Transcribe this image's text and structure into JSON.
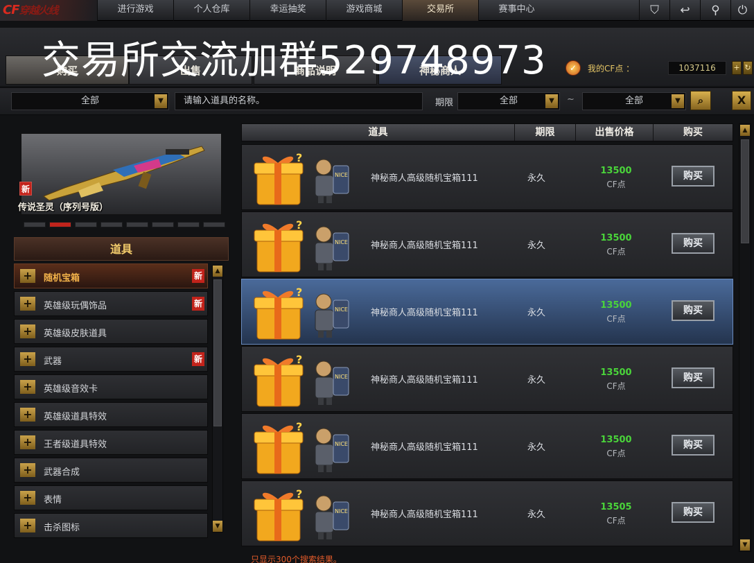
{
  "logo": {
    "text": "CF",
    "rest": "穿越火线"
  },
  "nav": {
    "items": [
      "进行游戏",
      "个人仓库",
      "幸运抽奖",
      "游戏商城",
      "交易所",
      "赛事中心"
    ],
    "active_index": 4,
    "icons": [
      "shield-icon",
      "back-icon",
      "wrench-icon",
      "power-icon"
    ]
  },
  "overlay_text": "交易所交流加群529748973",
  "tabs": [
    {
      "label": "购买"
    },
    {
      "label": "出售"
    },
    {
      "label": "商品说明"
    },
    {
      "label": "神秘商人"
    }
  ],
  "cf_points": {
    "label": "我的CF点 ：",
    "value": "1037116",
    "add_button": "+",
    "refresh_button": "↻"
  },
  "search": {
    "category_select": "全部",
    "placeholder": "请输入道具的名称。",
    "period_label": "期限",
    "period_from": "全部",
    "tilde": "~",
    "period_to": "全部",
    "search_icon": "search-icon",
    "close_label": "X"
  },
  "featured": {
    "new_badge": "新",
    "name": "传说圣灵（序列号版）"
  },
  "categories": {
    "header": "道具",
    "items": [
      {
        "label": "随机宝箱",
        "new": "新",
        "active": true
      },
      {
        "label": "英雄级玩偶饰品",
        "new": "新"
      },
      {
        "label": "英雄级皮肤道具",
        "new": ""
      },
      {
        "label": "武器",
        "new": "新"
      },
      {
        "label": "英雄级音效卡",
        "new": ""
      },
      {
        "label": "英雄级道具特效",
        "new": ""
      },
      {
        "label": "王者级道具特效",
        "new": ""
      },
      {
        "label": "武器合成",
        "new": ""
      },
      {
        "label": "表情",
        "new": ""
      },
      {
        "label": "击杀图标",
        "new": ""
      }
    ]
  },
  "table": {
    "headers": [
      "道具",
      "期限",
      "出售价格",
      "购买"
    ],
    "rows": [
      {
        "name": "神秘商人高级随机宝箱111",
        "period": "永久",
        "price": "13500",
        "unit": "CF点",
        "buy": "购买"
      },
      {
        "name": "神秘商人高级随机宝箱111",
        "period": "永久",
        "price": "13500",
        "unit": "CF点",
        "buy": "购买"
      },
      {
        "name": "神秘商人高级随机宝箱111",
        "period": "永久",
        "price": "13500",
        "unit": "CF点",
        "buy": "购买",
        "selected": true
      },
      {
        "name": "神秘商人高级随机宝箱111",
        "period": "永久",
        "price": "13500",
        "unit": "CF点",
        "buy": "购买"
      },
      {
        "name": "神秘商人高级随机宝箱111",
        "period": "永久",
        "price": "13500",
        "unit": "CF点",
        "buy": "购买"
      },
      {
        "name": "神秘商人高级随机宝箱111",
        "period": "永久",
        "price": "13505",
        "unit": "CF点",
        "buy": "购买"
      }
    ]
  },
  "result_note": "只显示300个搜索结果。"
}
